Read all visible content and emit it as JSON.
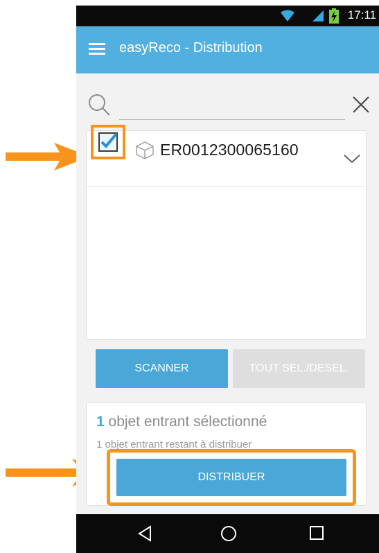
{
  "status_bar": {
    "time": "17:11"
  },
  "app_bar": {
    "title": "easyReco - Distribution"
  },
  "search": {
    "placeholder": "",
    "value": ""
  },
  "item": {
    "reference": "ER0012300065160",
    "checked": true
  },
  "buttons": {
    "scanner": "SCANNER",
    "toggle_select": "TOUT SEL./DESEL.",
    "distribute": "DISTRIBUER"
  },
  "summary": {
    "count": "1",
    "selected_text": " objet entrant sélectionné",
    "remaining_text": "1 objet entrant restant à distribuer"
  },
  "colors": {
    "accent": "#4aa7d8",
    "appbar": "#52b0e0",
    "highlight": "#f7941d",
    "disabled": "#dedede"
  },
  "icons": [
    "wifi-icon",
    "signal-icon",
    "battery-icon",
    "menu-icon",
    "search-icon",
    "close-icon",
    "package-icon",
    "chevron-down-icon",
    "back-icon",
    "home-icon",
    "recents-icon"
  ]
}
